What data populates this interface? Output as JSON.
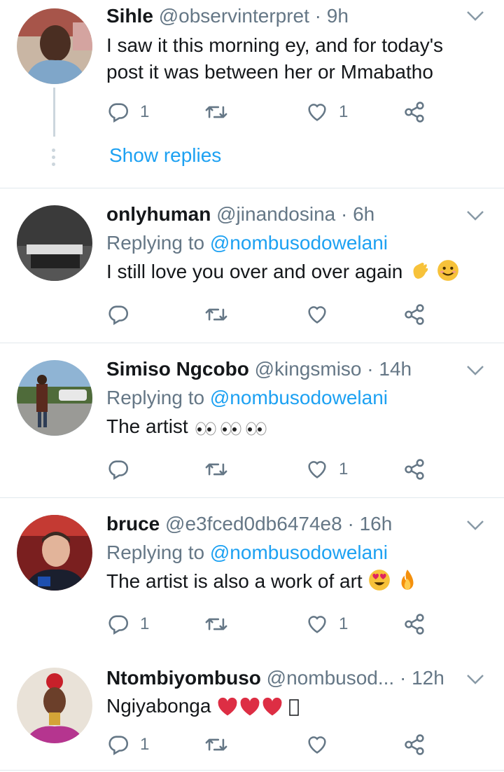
{
  "tweets": [
    {
      "name": "Sihle",
      "handle": "@observinterpret",
      "dot": "·",
      "time": "9h",
      "replying_prefix": "",
      "replying_to": "",
      "text": "I saw it this morning ey, and for today's post it was between her or Mmabatho",
      "reply_count": "1",
      "retweet_count": "",
      "like_count": "1",
      "show_replies": "Show replies"
    },
    {
      "name": "onlyhuman",
      "handle": "@jinandosina",
      "dot": "·",
      "time": "6h",
      "replying_prefix": "Replying to",
      "replying_to": "@nombusodowelani",
      "text": "I still love you over and over again",
      "reply_count": "",
      "retweet_count": "",
      "like_count": ""
    },
    {
      "name": "Simiso Ngcobo",
      "handle": "@kingsmiso",
      "dot": "·",
      "time": "14h",
      "replying_prefix": "Replying to",
      "replying_to": "@nombusodowelani",
      "text": "The artist",
      "reply_count": "",
      "retweet_count": "",
      "like_count": "1"
    },
    {
      "name": "bruce",
      "handle": "@e3fced0db6474e8",
      "dot": "·",
      "time": "16h",
      "replying_prefix": "Replying to",
      "replying_to": "@nombusodowelani",
      "text": "The artist is also a work of art",
      "reply_count": "1",
      "retweet_count": "",
      "like_count": "1"
    },
    {
      "name": "Ntombiyombuso",
      "handle": "@nombusod...",
      "dot": "·",
      "time": "12h",
      "replying_prefix": "",
      "replying_to": "",
      "text": "Ngiyabonga",
      "reply_count": "1",
      "retweet_count": "",
      "like_count": ""
    }
  ],
  "colors": {
    "accent": "#1da1f2",
    "secondary_text": "#657786",
    "heart": "#e0245e"
  },
  "icons": [
    "reply-icon",
    "retweet-icon",
    "like-icon",
    "share-icon",
    "chevron-down-icon"
  ]
}
